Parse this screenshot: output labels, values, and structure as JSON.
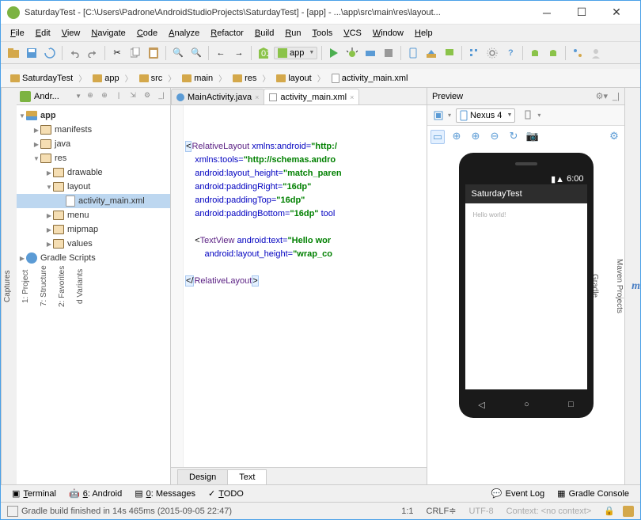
{
  "title": "SaturdayTest - [C:\\Users\\Padrone\\AndroidStudioProjects\\SaturdayTest] - [app] - ...\\app\\src\\main\\res\\layout...",
  "menus": [
    "File",
    "Edit",
    "View",
    "Navigate",
    "Code",
    "Analyze",
    "Refactor",
    "Build",
    "Run",
    "Tools",
    "VCS",
    "Window",
    "Help"
  ],
  "run_config": "app",
  "breadcrumbs": [
    "SaturdayTest",
    "app",
    "src",
    "main",
    "res",
    "layout",
    "activity_main.xml"
  ],
  "project_tab": "Andr...",
  "tree": {
    "root": "app",
    "nodes": [
      {
        "label": "manifests",
        "indent": 1,
        "icon": "res",
        "arr": "▶"
      },
      {
        "label": "java",
        "indent": 1,
        "icon": "res",
        "arr": "▶"
      },
      {
        "label": "res",
        "indent": 1,
        "icon": "res",
        "arr": "▼"
      },
      {
        "label": "drawable",
        "indent": 2,
        "icon": "res",
        "arr": "▶"
      },
      {
        "label": "layout",
        "indent": 2,
        "icon": "res",
        "arr": "▼"
      },
      {
        "label": "activity_main.xml",
        "indent": 3,
        "icon": "xml",
        "arr": "",
        "sel": true
      },
      {
        "label": "menu",
        "indent": 2,
        "icon": "res",
        "arr": "▶"
      },
      {
        "label": "mipmap",
        "indent": 2,
        "icon": "res",
        "arr": "▶"
      },
      {
        "label": "values",
        "indent": 2,
        "icon": "res",
        "arr": "▶"
      }
    ],
    "gradle": "Gradle Scripts"
  },
  "editor_tabs": [
    {
      "label": "MainActivity.java",
      "icon": "j",
      "active": false
    },
    {
      "label": "activity_main.xml",
      "icon": "x",
      "active": true
    }
  ],
  "code": {
    "lines": [
      {
        "t": "RelativeLayout",
        "a": "xmlns:android",
        "v": "\"http:/",
        "pre": "<",
        "ind": 0,
        "open": true
      },
      {
        "a": "xmlns:tools",
        "v": "\"http://schemas.andro",
        "ind": 1
      },
      {
        "a": "android:layout_height",
        "v": "\"match_paren",
        "ind": 1
      },
      {
        "a": "android:paddingRight",
        "v": "\"16dp\"",
        "ind": 1
      },
      {
        "a": "android:paddingTop",
        "v": "\"16dp\"",
        "ind": 1
      },
      {
        "a": "android:paddingBottom",
        "v": "\"16dp\"",
        "post": " tool",
        "ind": 1
      },
      {
        "blank": true
      },
      {
        "t": "TextView",
        "a": "android:text",
        "v": "\"Hello wor",
        "pre": "<",
        "ind": 1
      },
      {
        "a": "android:layout_height",
        "v": "\"wrap_co",
        "ind": 2
      },
      {
        "blank": true
      },
      {
        "close": "RelativeLayout",
        "ind": 0
      }
    ]
  },
  "bottom_tabs": [
    "Design",
    "Text"
  ],
  "preview": {
    "title": "Preview",
    "device": "Nexus 4",
    "status_time": "6:00",
    "app_title": "SaturdayTest",
    "content": "Hello world!"
  },
  "toolwindows_left": [
    "Terminal",
    "6: Android",
    "0: Messages",
    "TODO"
  ],
  "toolwindows_right": [
    "Event Log",
    "Gradle Console"
  ],
  "left_tabs": [
    "Captures",
    "1: Project",
    "7: Structure",
    "2: Favorites",
    "d Variants"
  ],
  "right_tabs": [
    "Maven Projects",
    "Gradle",
    "Preview"
  ],
  "status": {
    "msg": "Gradle build finished in 14s 465ms (2015-09-05 22:47)",
    "pos": "1:1",
    "eol": "CRLF",
    "enc": "UTF-8",
    "ctx": "Context: <no context>"
  }
}
